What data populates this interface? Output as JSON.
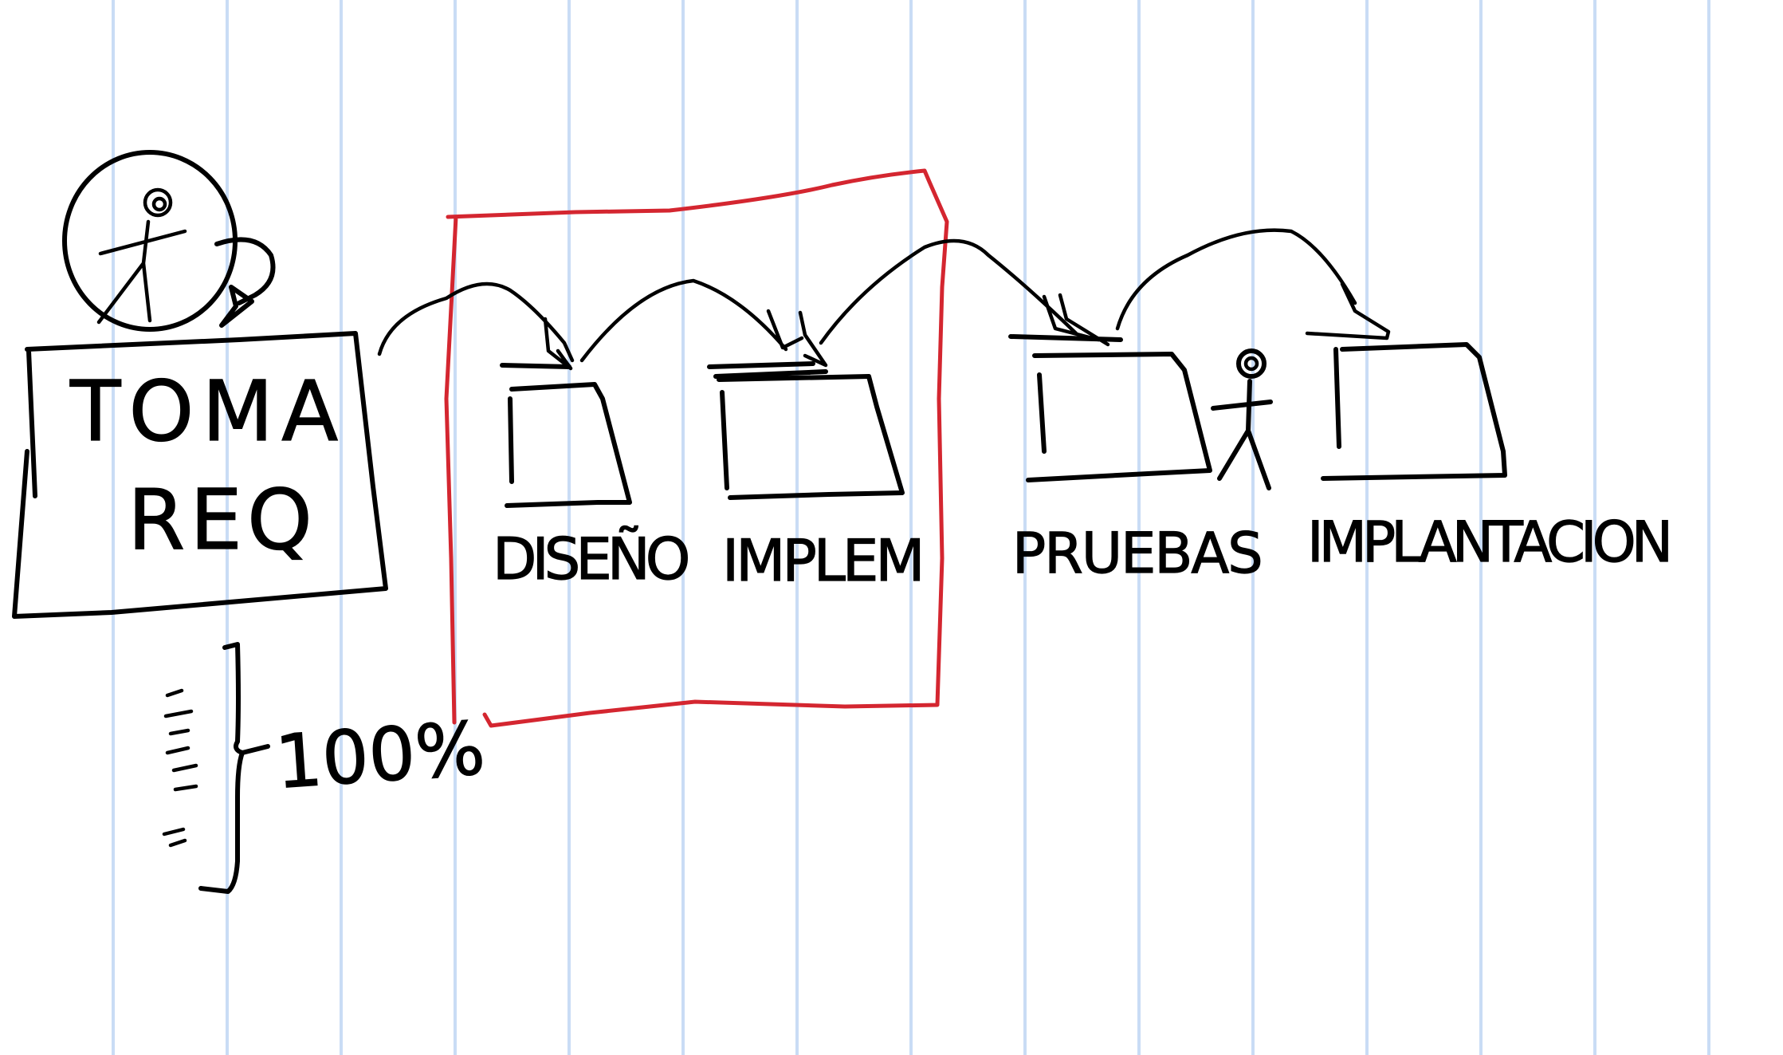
{
  "colors": {
    "ink": "#000000",
    "highlight": "#d42630",
    "ruling": "#c9dcf5",
    "paper": "#ffffff"
  },
  "stages": {
    "requirements": {
      "line1": "TOMA",
      "line2": "REQ"
    },
    "design": "DISEÑO",
    "implementation": "IMPLEM",
    "testing": "PRUEBAS",
    "deployment": "IMPLANTACION"
  },
  "annotation": {
    "percent": "100%"
  },
  "icons": [
    "stick-figure-in-circle-icon",
    "stick-figure-icon",
    "curly-brace-icon"
  ]
}
